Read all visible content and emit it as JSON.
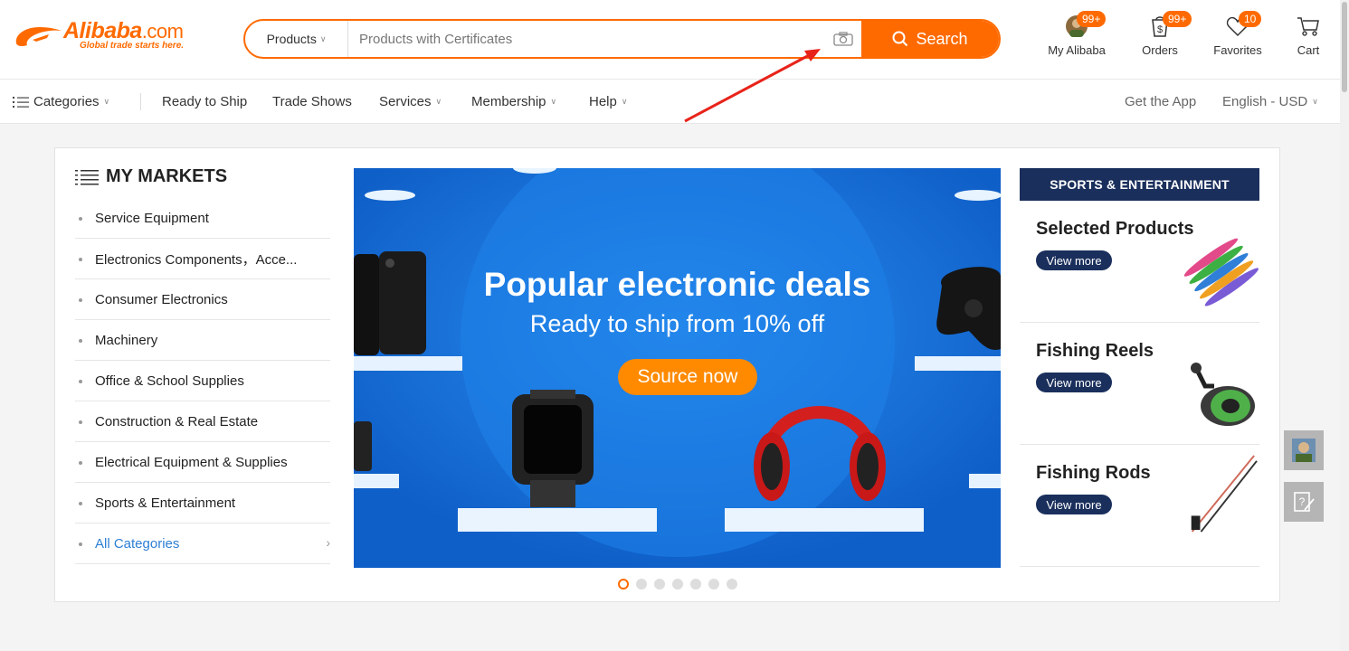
{
  "header": {
    "logo_text": "Alibaba",
    "logo_suffix": ".com",
    "logo_tagline": "Global trade starts here.",
    "search": {
      "type_label": "Products",
      "placeholder": "Products with Certificates",
      "button_label": "Search"
    },
    "actions": [
      {
        "label": "My Alibaba",
        "badge": "99+",
        "icon": "avatar-icon"
      },
      {
        "label": "Orders",
        "badge": "99+",
        "icon": "orders-icon"
      },
      {
        "label": "Favorites",
        "badge": "10",
        "icon": "heart-icon"
      },
      {
        "label": "Cart",
        "badge": "",
        "icon": "cart-icon"
      }
    ]
  },
  "nav": {
    "categories": "Categories",
    "items": [
      "Ready to Ship",
      "Trade Shows",
      "Services",
      "Membership",
      "Help"
    ],
    "get_app": "Get the App",
    "language": "English - USD"
  },
  "markets": {
    "title": "MY MARKETS",
    "items": [
      "Service Equipment",
      "Electronics Components，Acce...",
      "Consumer Electronics",
      "Machinery",
      "Office & School Supplies",
      "Construction & Real Estate",
      "Electrical Equipment & Supplies",
      "Sports & Entertainment"
    ],
    "all_label": "All Categories"
  },
  "banner": {
    "title": "Popular electronic deals",
    "subtitle": "Ready to ship from 10% off",
    "cta": "Source now",
    "slide_count": 7,
    "active_slide": 1
  },
  "sports": {
    "header": "SPORTS & ENTERTAINMENT",
    "promos": [
      {
        "title": "Selected Products",
        "button": "View more"
      },
      {
        "title": "Fishing Reels",
        "button": "View more"
      },
      {
        "title": "Fishing Rods",
        "button": "View more"
      }
    ]
  },
  "colors": {
    "brand": "#ff6a00",
    "navy": "#1a2f5c",
    "banner_blue": "#1b7ae0",
    "link_blue": "#2d7fd3"
  }
}
